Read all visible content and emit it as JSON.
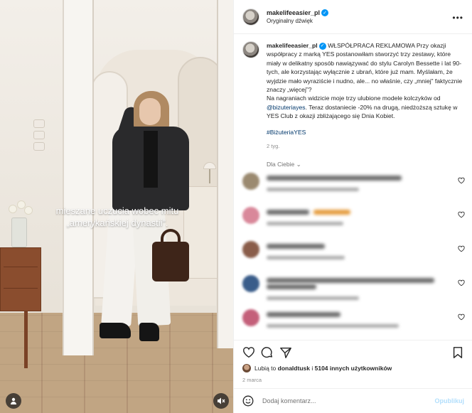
{
  "media": {
    "overlay_text": "mieszane uczucia wobec mitu „amerykańskiej dynastii”.",
    "user_icon": "person-icon",
    "mute_icon": "speaker-muted-icon"
  },
  "header": {
    "username": "makelifeeasier_pl",
    "audio": "Oryginalny dźwięk",
    "more_icon": "more-options-icon"
  },
  "caption": {
    "username": "makelifeeasier_pl",
    "badge": "WŁSPÓŁPRACA REKLAMOWA",
    "text1": "Przy okazji współpracy z marką YES postanowiłam stworzyć trzy zestawy, które miały w delikatny sposób nawiązywać do stylu Carolyn Bessette i lat 90-tych, ale korzystając wyłącznie z ubrań, które już mam. Myślałam, że wyjdzie mało wyraziście i nudno, ale... no właśnie, czy „mniej” faktycznie znaczy „więcej”?",
    "text2": "Na nagraniach widzicie moje trzy ulubione modele kolczyków od",
    "mention": "@bizuteriayes",
    "text3": ". Teraz dostaniecie -20% na drugą, niedżoższą sztukę w YES Club z okazji zbliżającego się Dnia Kobiet.",
    "hashtag": "#BiżuteriaYES",
    "time": "2 tyg."
  },
  "sort_label": "Dla Ciebie",
  "comments": [
    {
      "avatar_color": "#9b8a70"
    },
    {
      "avatar_color": "#d9889a"
    },
    {
      "avatar_color": "#8a5d4a"
    },
    {
      "avatar_color": "#3a5d8a"
    },
    {
      "avatar_color": "#c4607a"
    }
  ],
  "actions": {
    "like_icon": "heart-icon",
    "comment_icon": "comment-icon",
    "share_icon": "share-icon",
    "save_icon": "bookmark-icon"
  },
  "likes": {
    "prefix": "Lubią to",
    "user": "donaldtusk",
    "middle": "i",
    "others": "5104 innych użytkowników"
  },
  "date": "2 marca",
  "add_comment": {
    "placeholder": "Dodaj komentarz...",
    "publish": "Opublikuj"
  }
}
